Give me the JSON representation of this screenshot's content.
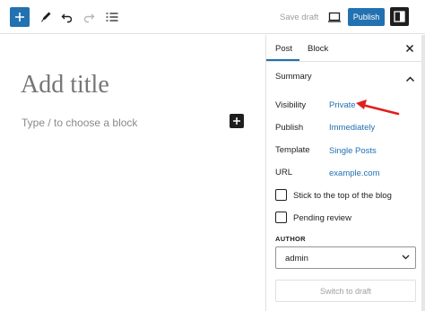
{
  "toolbar": {
    "add_icon": "plus-icon",
    "tools_icon": "pencil-icon",
    "undo_icon": "undo-icon",
    "redo_icon": "redo-icon",
    "list_view_icon": "list-view-icon",
    "save_draft": "Save draft",
    "preview_icon": "desktop-icon",
    "publish": "Publish",
    "settings_icon": "sidebar-icon"
  },
  "editor": {
    "title_placeholder": "Add title",
    "block_placeholder": "Type / to choose a block"
  },
  "sidebar": {
    "tabs": [
      {
        "label": "Post",
        "active": true
      },
      {
        "label": "Block",
        "active": false
      }
    ],
    "summary": {
      "title": "Summary",
      "rows": [
        {
          "label": "Visibility",
          "value": "Private"
        },
        {
          "label": "Publish",
          "value": "Immediately"
        },
        {
          "label": "Template",
          "value": "Single Posts"
        },
        {
          "label": "URL",
          "value": "example.com"
        }
      ],
      "checkboxes": [
        {
          "label": "Stick to the top of the blog",
          "checked": false
        },
        {
          "label": "Pending review",
          "checked": false
        }
      ],
      "author_label": "AUTHOR",
      "author_value": "admin",
      "switch_button": "Switch to draft"
    }
  },
  "colors": {
    "accent": "#2271b1",
    "annotation_arrow": "#e0201c"
  }
}
